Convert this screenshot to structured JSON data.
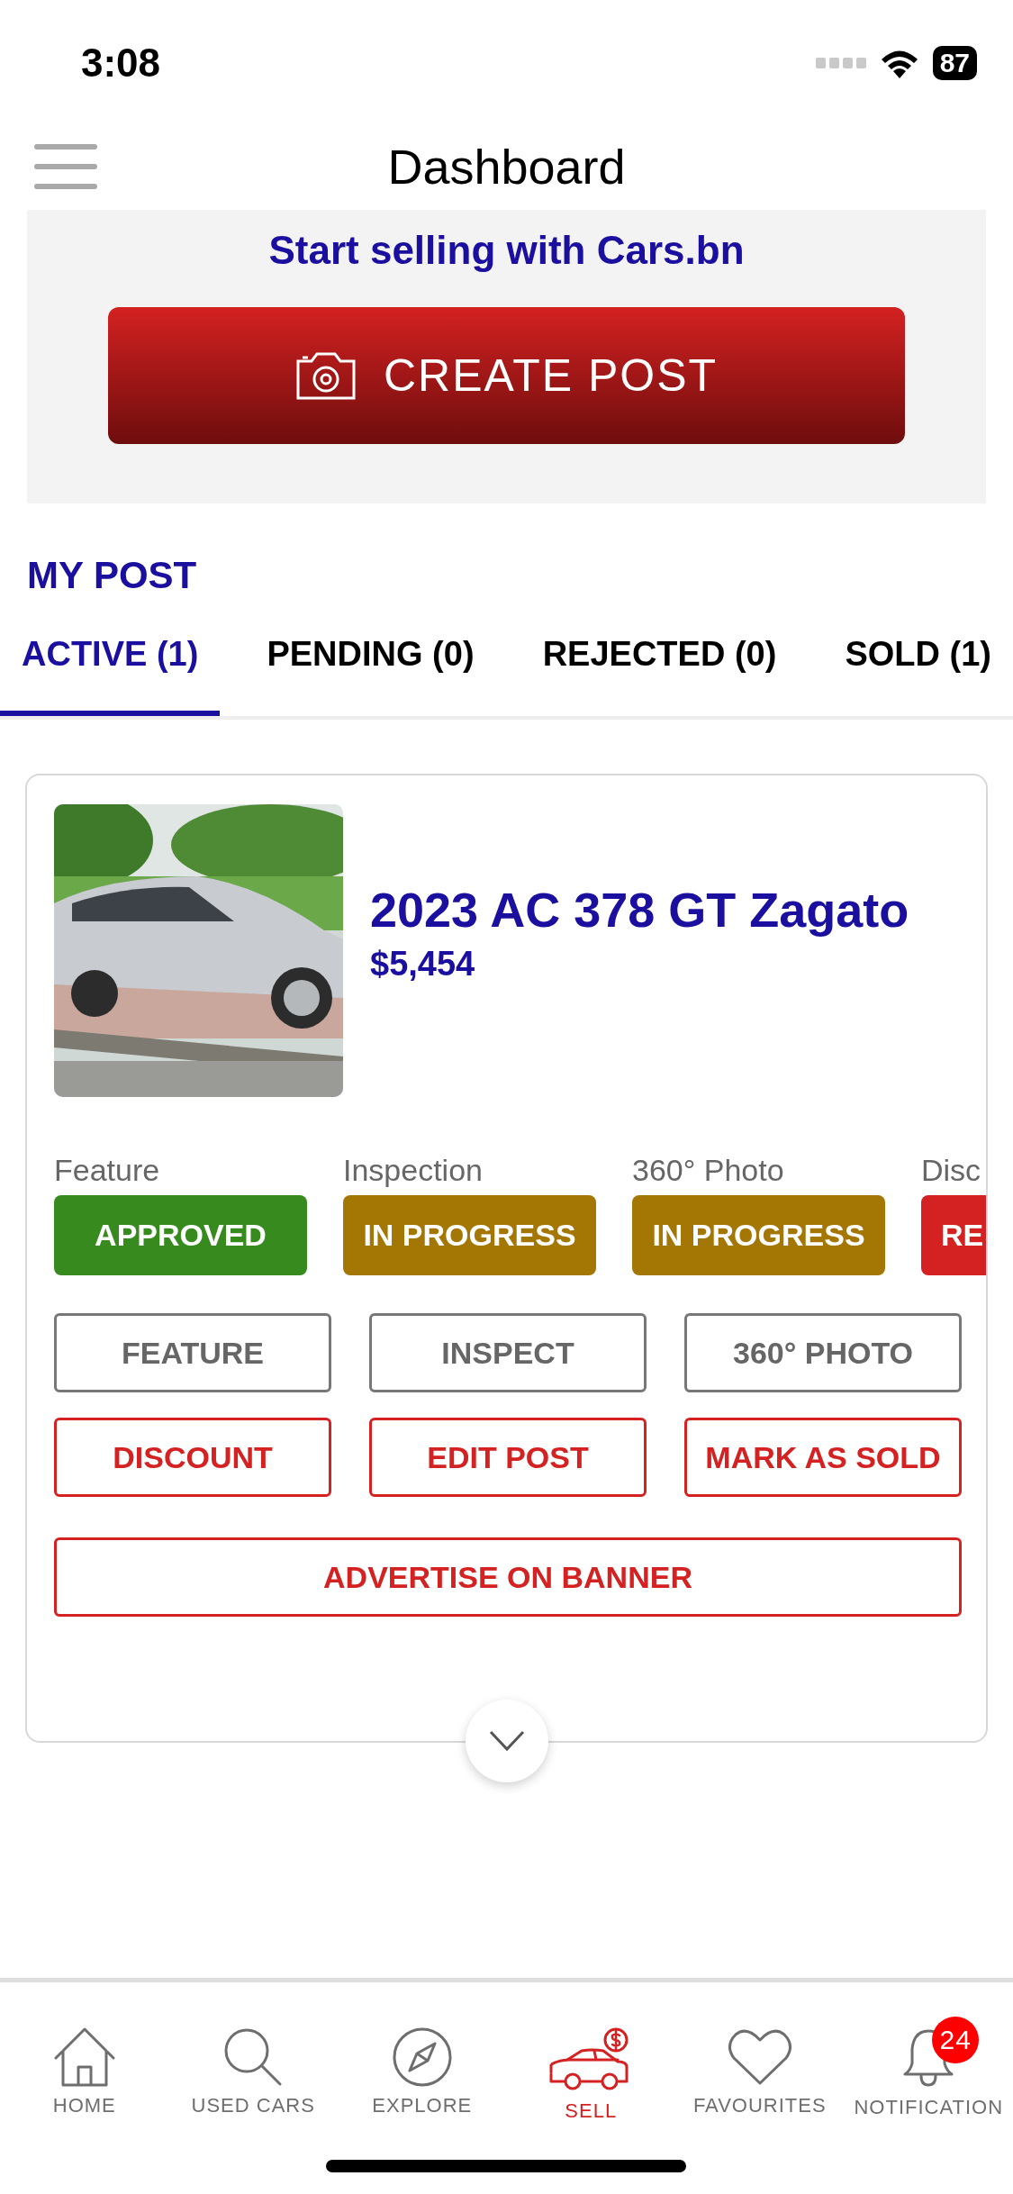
{
  "status_bar": {
    "time": "3:08",
    "battery": "87"
  },
  "header": {
    "title": "Dashboard"
  },
  "banner": {
    "title": "Start selling with Cars.bn",
    "button": "CREATE POST"
  },
  "section_title": "MY POST",
  "tabs": [
    {
      "label": "ACTIVE (1)",
      "selected": true
    },
    {
      "label": "PENDING (0)",
      "selected": false
    },
    {
      "label": "REJECTED (0)",
      "selected": false
    },
    {
      "label": "SOLD (1)",
      "selected": false
    }
  ],
  "post": {
    "title": "2023 AC 378 GT Zagato",
    "price": "$5,454",
    "statuses": [
      {
        "label": "Feature",
        "status": "APPROVED",
        "color": "#368a1e"
      },
      {
        "label": "Inspection",
        "status": "IN PROGRESS",
        "color": "#a47704"
      },
      {
        "label": "360° Photo",
        "status": "IN PROGRESS",
        "color": "#a47704"
      },
      {
        "label": "Disc",
        "status": "RE",
        "color": "#d42121"
      }
    ],
    "actions": [
      {
        "label": "FEATURE",
        "kind": "neutral"
      },
      {
        "label": "INSPECT",
        "kind": "neutral"
      },
      {
        "label": "360° PHOTO",
        "kind": "neutral"
      },
      {
        "label": "DISCOUNT",
        "kind": "primary"
      },
      {
        "label": "EDIT POST",
        "kind": "primary"
      },
      {
        "label": "MARK AS SOLD",
        "kind": "primary"
      },
      {
        "label": "ADVERTISE ON BANNER",
        "kind": "wide"
      }
    ]
  },
  "nav": [
    {
      "label": "HOME",
      "kind": "home",
      "selected": false
    },
    {
      "label": "USED CARS",
      "kind": "search",
      "selected": false
    },
    {
      "label": "EXPLORE",
      "kind": "compass",
      "selected": false
    },
    {
      "label": "SELL",
      "kind": "sell",
      "selected": true
    },
    {
      "label": "FAVOURITES",
      "kind": "heart",
      "selected": false
    },
    {
      "label": "NOTIFICATION",
      "kind": "bell",
      "selected": false,
      "badge": "24"
    }
  ]
}
